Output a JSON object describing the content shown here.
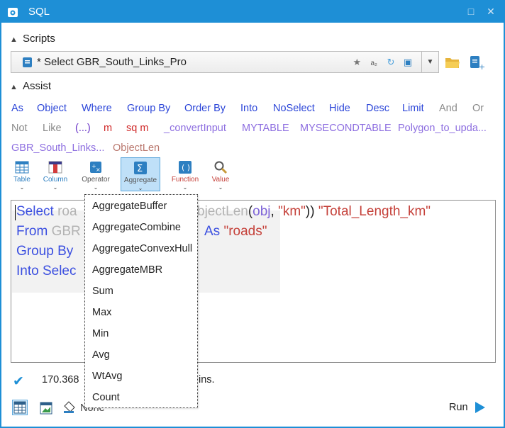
{
  "window": {
    "title": "SQL"
  },
  "scripts": {
    "header": "Scripts",
    "current": "* Select GBR_South_Links_Pro"
  },
  "assist": {
    "header": "Assist",
    "keywords": [
      "As",
      "Object",
      "Where",
      "Group By",
      "Order By",
      "Into",
      "NoSelect",
      "Hide",
      "Desc",
      "Limit",
      "And",
      "Or",
      "Not",
      "Like",
      "(...)",
      "m",
      "sq m",
      "_convertInput",
      "MYTABLE",
      "MYSECONDTABLE",
      "Polygon_to_upda...",
      "GBR_South_Links...",
      "ObjectLen"
    ]
  },
  "toolbar": {
    "table": "Table",
    "column": "Column",
    "operator": "Operator",
    "aggregate": "Aggregate",
    "function": "Function",
    "value": "Value"
  },
  "editor": {
    "line1": {
      "kw": "Select",
      "a": "roa",
      "b": "bjectLen",
      "c": "(",
      "d": "obj",
      "e": ", ",
      "f": "\"km\"",
      "g": ")) ",
      "h": "\"Total_Length_km\""
    },
    "line2": {
      "kw": "From",
      "a": "GBR",
      "b": "As",
      "c": "\"roads\""
    },
    "line3": {
      "kw": "Group By"
    },
    "line4": {
      "kw": "Into Selec"
    }
  },
  "status": {
    "value": "170.368",
    "tail": "ins."
  },
  "bottom": {
    "none_label": "None",
    "run_label": "Run"
  },
  "aggregate_menu": [
    "AggregateBuffer",
    "AggregateCombine",
    "AggregateConvexHull",
    "AggregateMBR",
    "Sum",
    "Max",
    "Min",
    "Avg",
    "WtAvg",
    "Count"
  ],
  "colors": {
    "accent": "#1e8fd6",
    "keyword": "#2b45d8",
    "string": "#c5413a"
  }
}
